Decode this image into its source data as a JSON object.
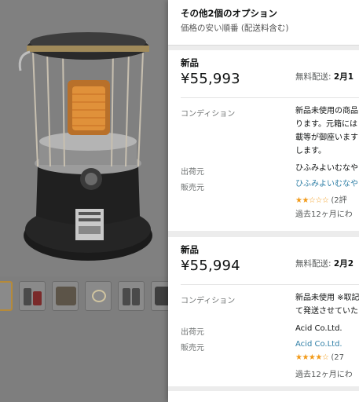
{
  "panel": {
    "title": "その他2個のオプション",
    "subtitle": "価格の安い順番 (配送料含む)"
  },
  "offers": [
    {
      "condition": "新品",
      "price": "¥55,993",
      "shipping_prefix": "無料配送: ",
      "shipping_date": "2月1",
      "condition_label": "コンディション",
      "condition_text": [
        "新品未使用の商品",
        "ります。元箱には",
        "載等が御座います",
        "します。"
      ],
      "ships_from_label": "出荷元",
      "ships_from": "ひふみよいむなや",
      "sold_by_label": "販売元",
      "sold_by": "ひふみよいむなや",
      "rating": "★★☆☆☆",
      "rating_value": 2.5,
      "rating_count": "(2評",
      "rating_period": "過去12ヶ月にわ"
    },
    {
      "condition": "新品",
      "price": "¥55,994",
      "shipping_prefix": "無料配送: ",
      "shipping_date": "2月2",
      "condition_label": "コンディション",
      "condition_text": [
        "新品未使用 ※取記",
        "て発送させていた"
      ],
      "ships_from_label": "出荷元",
      "ships_from": "Acid Co.Ltd.",
      "sold_by_label": "販売元",
      "sold_by": "Acid Co.Ltd.",
      "rating": "★★★★☆",
      "rating_value": 4.5,
      "rating_count": "(27",
      "rating_period": "過去12ヶ月にわ"
    }
  ],
  "colors": {
    "link": "#2f7fa6",
    "star": "#f29a18",
    "overlay": "#7e7e7e"
  },
  "icons": [
    "heater-product-image",
    "thumbnail-image"
  ]
}
